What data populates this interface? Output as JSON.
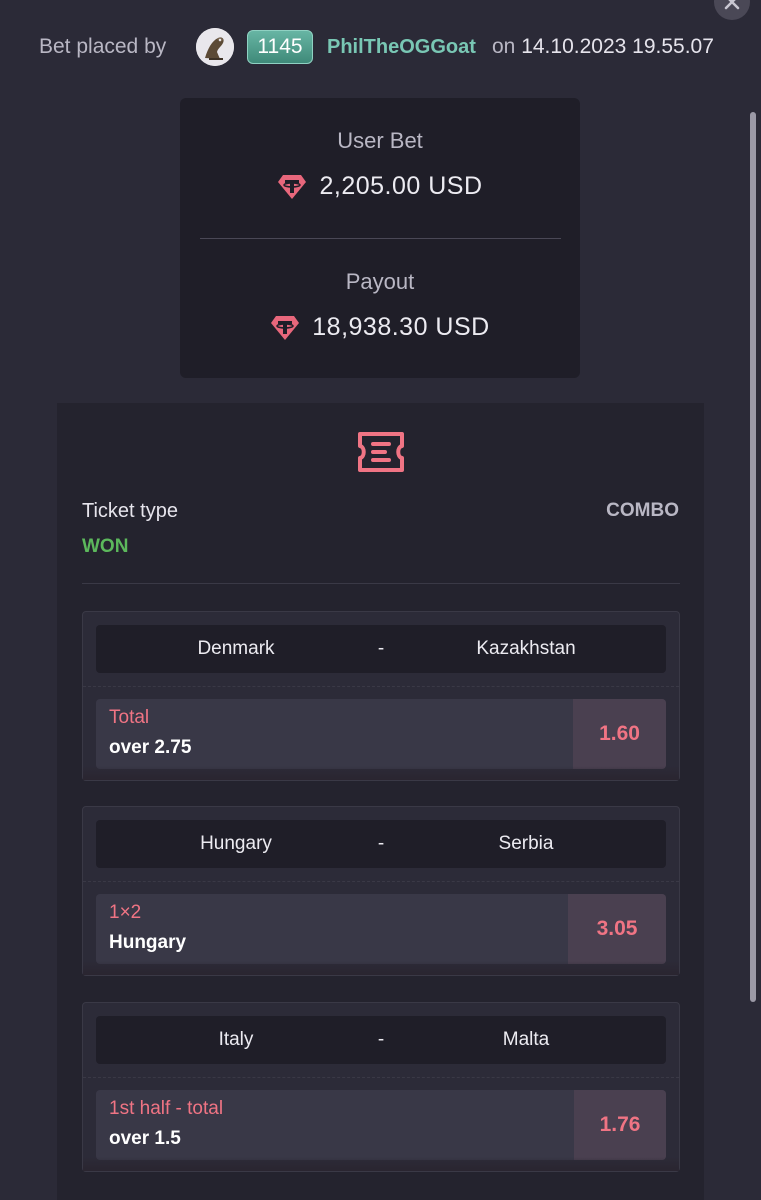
{
  "header": {
    "placed_by_label": "Bet placed by",
    "level": "1145",
    "username": "PhilTheOGGoat",
    "on_label": "on",
    "datetime": "14.10.2023 19.55.07"
  },
  "summary": {
    "user_bet_label": "User Bet",
    "user_bet_amount": "2,205.00 USD",
    "payout_label": "Payout",
    "payout_amount": "18,938.30 USD",
    "currency_icon": "tether-icon"
  },
  "ticket": {
    "type_label": "Ticket type",
    "type_value": "COMBO",
    "status": "WON",
    "bets": [
      {
        "team_a": "Denmark",
        "separator": "-",
        "team_b": "Kazakhstan",
        "market": "Total",
        "selection": "over 2.75",
        "odds": "1.60"
      },
      {
        "team_a": "Hungary",
        "separator": "-",
        "team_b": "Serbia",
        "market": "1×2",
        "selection": "Hungary",
        "odds": "3.05"
      },
      {
        "team_a": "Italy",
        "separator": "-",
        "team_b": "Malta",
        "market": "1st half - total",
        "selection": "over 1.5",
        "odds": "1.76"
      }
    ]
  },
  "colors": {
    "background": "#2b2a37",
    "card": "#1f1e28",
    "accent_pink": "#f07484",
    "won_green": "#5cb85c",
    "username_teal": "#79c7b4"
  }
}
